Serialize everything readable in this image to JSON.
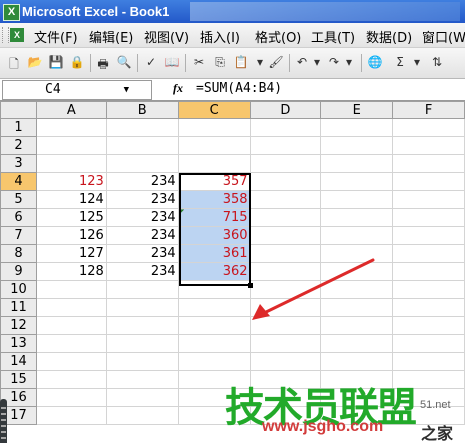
{
  "window": {
    "title": "Microsoft Excel - Book1",
    "app_icon": "X"
  },
  "menu": {
    "items": [
      "文件(F)",
      "编辑(E)",
      "视图(V)",
      "插入(I)",
      "格式(O)",
      "工具(T)",
      "数据(D)",
      "窗口(W)"
    ]
  },
  "formula_bar": {
    "name_box": "C4",
    "fx_label": "fx",
    "formula": "=SUM(A4:B4)"
  },
  "grid": {
    "columns": [
      "A",
      "B",
      "C",
      "D",
      "E",
      "F"
    ],
    "active_column": "C",
    "rows": [
      {
        "num": "1",
        "a": "",
        "b": "",
        "c": ""
      },
      {
        "num": "2",
        "a": "",
        "b": "",
        "c": ""
      },
      {
        "num": "3",
        "a": "",
        "b": "",
        "c": ""
      },
      {
        "num": "4",
        "a": "123",
        "b": "234",
        "c": "357"
      },
      {
        "num": "5",
        "a": "124",
        "b": "234",
        "c": "358"
      },
      {
        "num": "6",
        "a": "125",
        "b": "234",
        "c": "715"
      },
      {
        "num": "7",
        "a": "126",
        "b": "234",
        "c": "360"
      },
      {
        "num": "8",
        "a": "127",
        "b": "234",
        "c": "361"
      },
      {
        "num": "9",
        "a": "128",
        "b": "234",
        "c": "362"
      },
      {
        "num": "10",
        "a": "",
        "b": "",
        "c": ""
      },
      {
        "num": "11",
        "a": "",
        "b": "",
        "c": ""
      },
      {
        "num": "12",
        "a": "",
        "b": "",
        "c": ""
      },
      {
        "num": "13",
        "a": "",
        "b": "",
        "c": ""
      },
      {
        "num": "14",
        "a": "",
        "b": "",
        "c": ""
      },
      {
        "num": "15",
        "a": "",
        "b": "",
        "c": ""
      },
      {
        "num": "16",
        "a": "",
        "b": "",
        "c": ""
      },
      {
        "num": "17",
        "a": "",
        "b": "",
        "c": ""
      }
    ]
  },
  "watermark": {
    "main": "技术员联盟",
    "url": "www.jsgho.com",
    "suffix": "之家",
    "small": "51.net"
  },
  "colors": {
    "red_text": "#c8141c",
    "selection": "#bcd4f2",
    "active_header": "#f7c66d",
    "arrow": "#dd2a2a"
  }
}
